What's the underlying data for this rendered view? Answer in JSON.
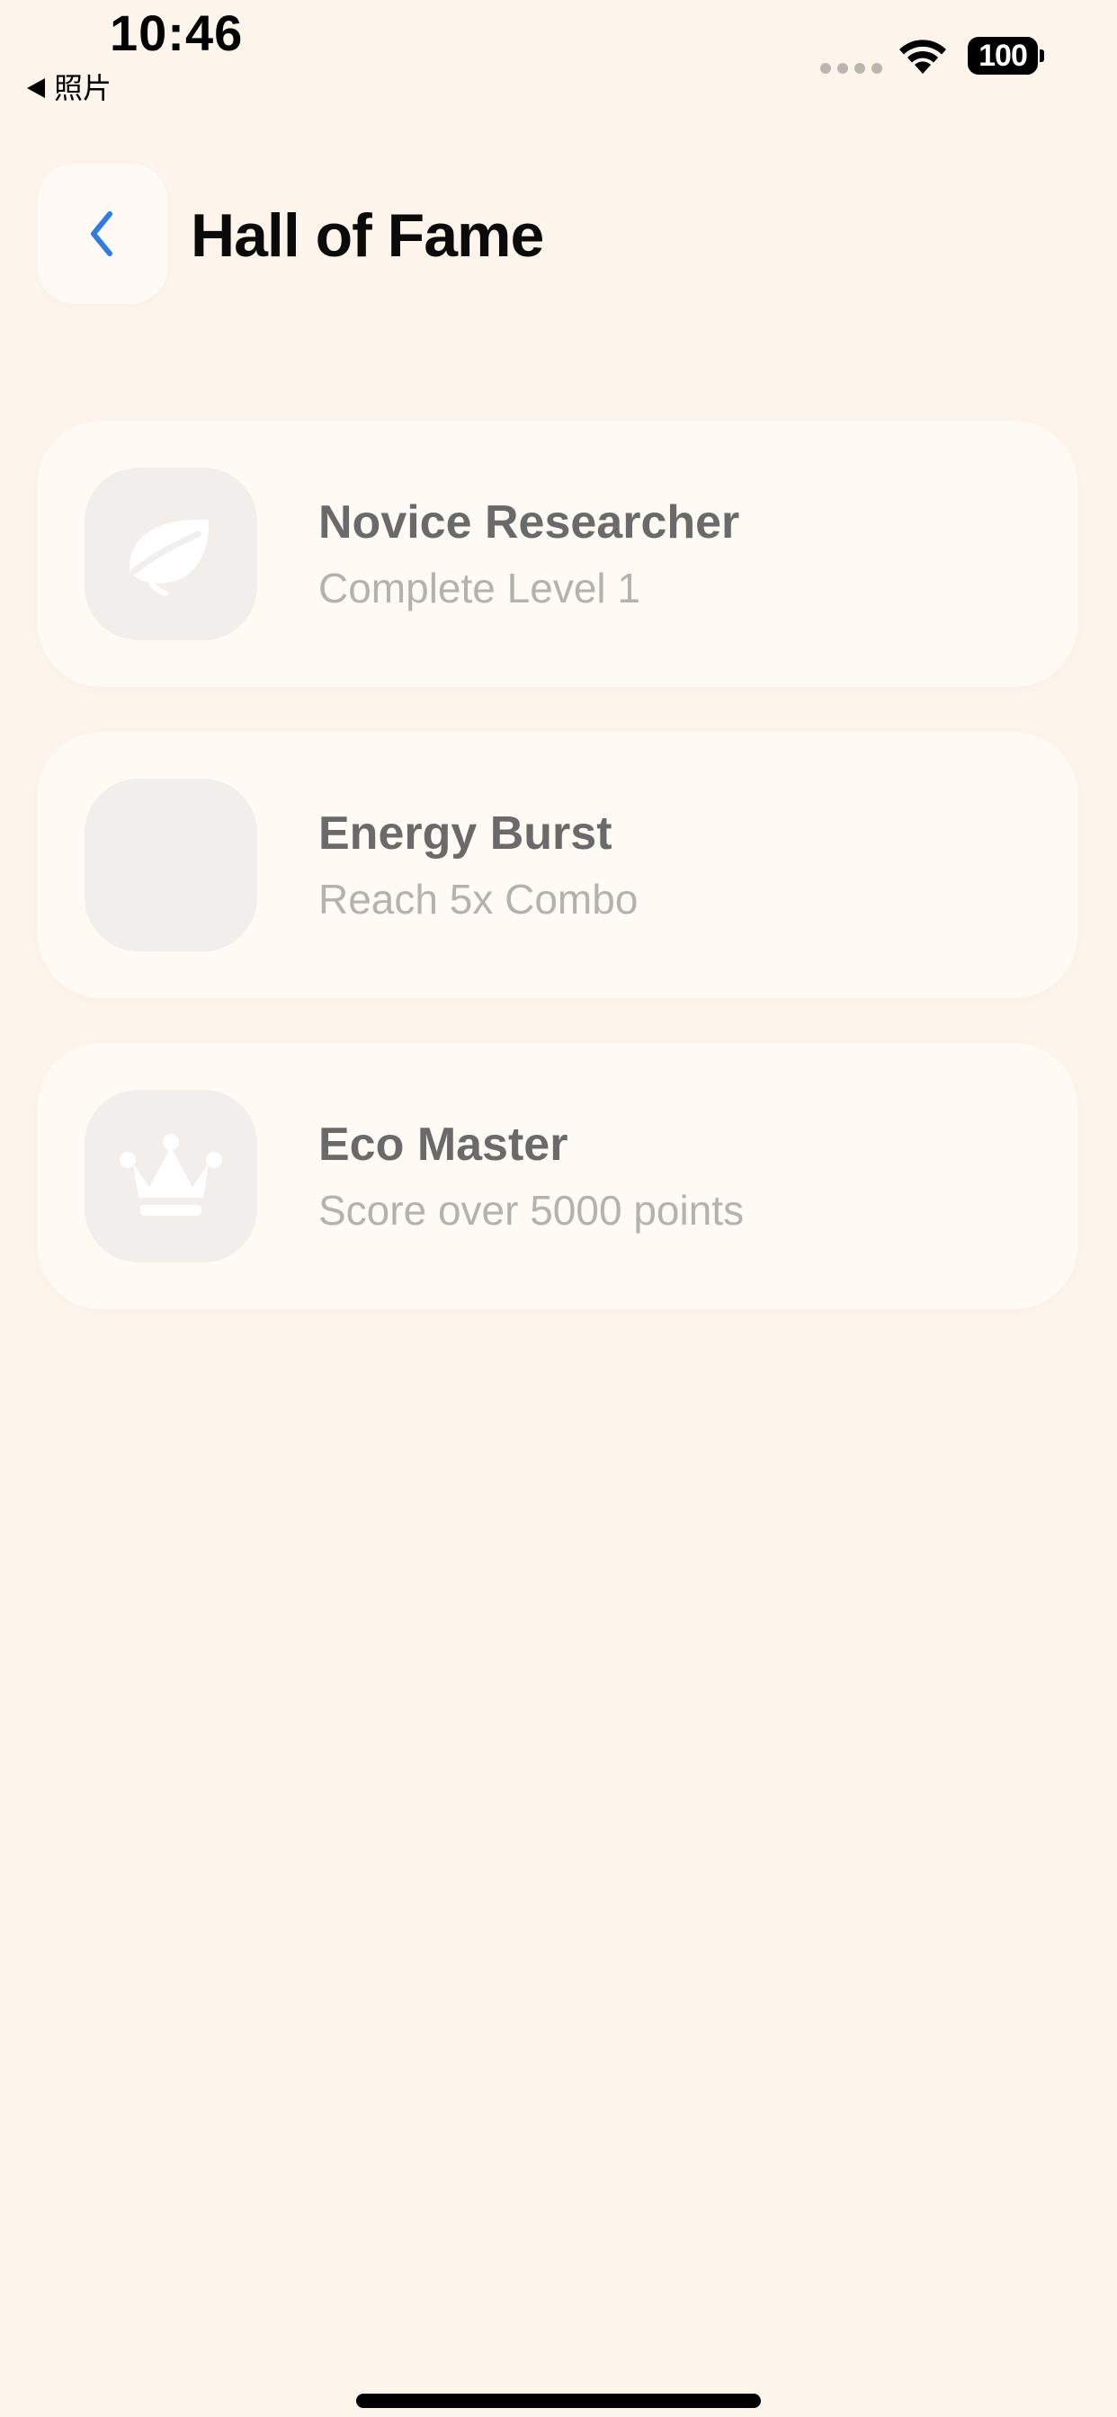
{
  "status_bar": {
    "time": "10:46",
    "back_app": "照片",
    "battery": "100"
  },
  "header": {
    "title": "Hall of Fame"
  },
  "achievements": [
    {
      "title": "Novice Researcher",
      "description": "Complete Level 1",
      "icon": "leaf-icon"
    },
    {
      "title": "Energy Burst",
      "description": "Reach 5x Combo",
      "icon": "empty-badge"
    },
    {
      "title": "Eco Master",
      "description": "Score over 5000 points",
      "icon": "crown-icon"
    }
  ],
  "colors": {
    "background": "#fdf5ec",
    "card": "#fffaf4",
    "badge": "#f1eeeb",
    "accent": "#2f7de0",
    "title_text": "#6a6a6a",
    "subtitle_text": "#b5b2ae"
  }
}
